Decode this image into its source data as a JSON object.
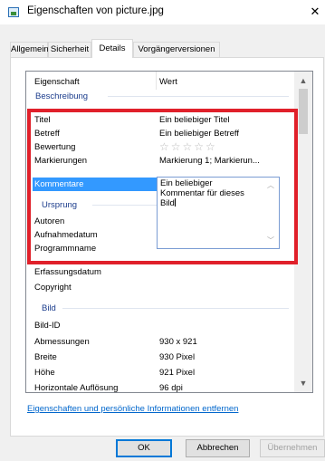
{
  "window": {
    "title": "Eigenschaften von picture.jpg",
    "close_glyph": "✕"
  },
  "tabs": [
    "Allgemein",
    "Sicherheit",
    "Details",
    "Vorgängerversionen"
  ],
  "active_tab": "Details",
  "list": {
    "header": {
      "prop": "Eigenschaft",
      "val": "Wert"
    },
    "groups": {
      "beschreibung": "Beschreibung",
      "ursprung": "Ursprung",
      "bild": "Bild"
    },
    "rows": {
      "titel": {
        "prop": "Titel",
        "val": "Ein beliebiger Titel"
      },
      "betreff": {
        "prop": "Betreff",
        "val": "Ein beliebiger Betreff"
      },
      "bewertung": {
        "prop": "Bewertung",
        "val": "☆☆☆☆☆",
        "rating": 0,
        "max": 5
      },
      "markierungen": {
        "prop": "Markierungen",
        "val": "Markierung 1; Markierun..."
      },
      "kommentare": {
        "prop": "Kommentare",
        "val": ""
      },
      "autoren": {
        "prop": "Autoren",
        "val": ""
      },
      "aufnahmedatum": {
        "prop": "Aufnahmedatum",
        "val": ""
      },
      "programmname": {
        "prop": "Programmname",
        "val": ""
      },
      "erfassungsdatum": {
        "prop": "Erfassungsdatum",
        "val": ""
      },
      "copyright": {
        "prop": "Copyright",
        "val": ""
      },
      "bild_id": {
        "prop": "Bild-ID",
        "val": ""
      },
      "abmessungen": {
        "prop": "Abmessungen",
        "val": "930 x 921"
      },
      "breite": {
        "prop": "Breite",
        "val": "930 Pixel"
      },
      "hoehe": {
        "prop": "Höhe",
        "val": "921 Pixel"
      },
      "horizontale": {
        "prop": "Horizontale Auflösung",
        "val": "96 dpi"
      }
    },
    "comment_editor": "Ein beliebiger\nKommentar für dieses\nBild"
  },
  "link": "Eigenschaften und persönliche Informationen entfernen",
  "buttons": {
    "ok": "OK",
    "cancel": "Abbrechen",
    "apply": "Übernehmen"
  },
  "colors": {
    "highlight": "#e0202a",
    "group": "#1b3c8c",
    "selection": "#3399ff",
    "link": "#0066cc"
  }
}
